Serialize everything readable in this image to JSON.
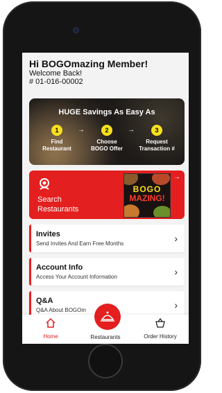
{
  "header": {
    "greeting": "Hi BOGOmazing Member!",
    "welcome": "Welcome Back!",
    "member_number": "# 01-016-00002"
  },
  "banner": {
    "title": "HUGE Savings As Easy As",
    "steps": [
      {
        "number": "1",
        "line1": "Find",
        "line2": "Restaurant"
      },
      {
        "number": "2",
        "line1": "Choose",
        "line2": "BOGO Offer"
      },
      {
        "number": "3",
        "line1": "Request",
        "line2": "Transaction #"
      }
    ]
  },
  "search_card": {
    "title": "Search",
    "subtitle": "Restaurants",
    "logo_line1": "BOGO",
    "logo_line2": "MAZING!"
  },
  "list": [
    {
      "title": "Invites",
      "subtitle": "Send Invites And Earn Free Months"
    },
    {
      "title": "Account Info",
      "subtitle": "Access Your Account Information"
    },
    {
      "title": "Q&A",
      "subtitle": "Q&A About BOGOm"
    }
  ],
  "nav": {
    "home": "Home",
    "restaurants": "Restaurants",
    "order_history": "Order History"
  },
  "colors": {
    "accent": "#e41f1f",
    "step_badge": "#f7e01f"
  },
  "icons": {
    "search_card": "search-location-icon",
    "home": "home-icon",
    "restaurants": "cloche-icon",
    "order_history": "basket-icon",
    "chevron": "chevron-right-icon"
  }
}
